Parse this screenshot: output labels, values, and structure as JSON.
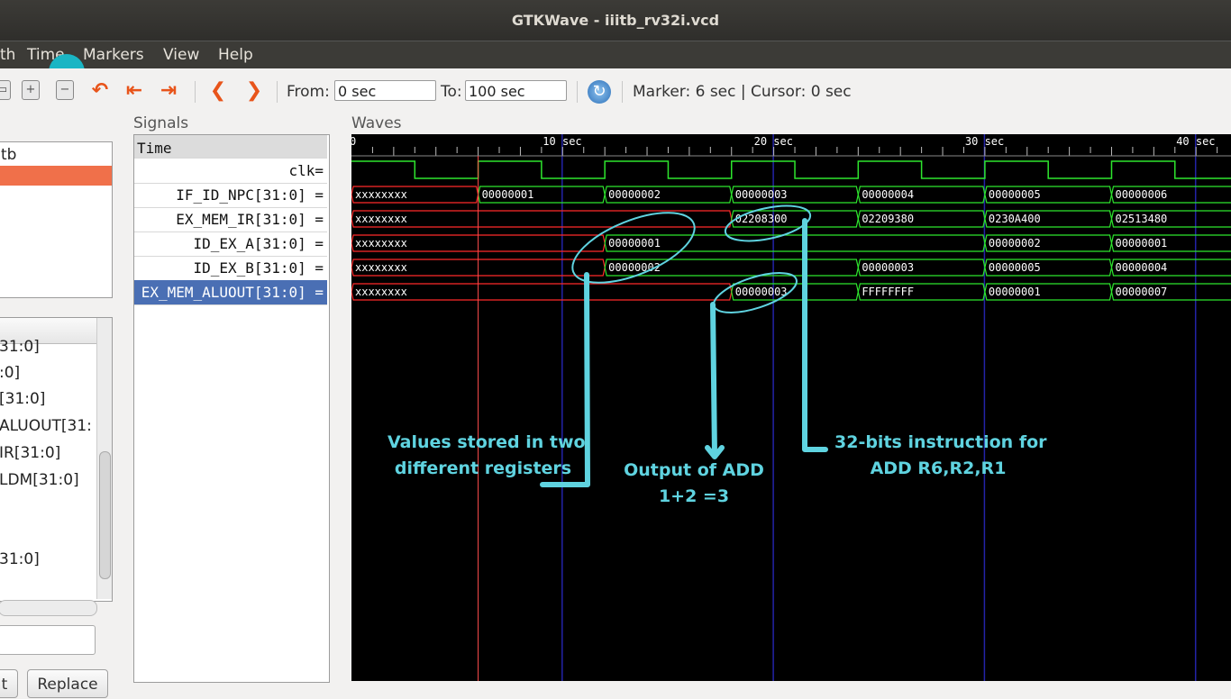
{
  "window": {
    "title": "GTKWave - iiitb_rv32i.vcd"
  },
  "menu": [
    "th",
    "Time",
    "Markers",
    "View",
    "Help"
  ],
  "toolbar": {
    "from_label": "From:",
    "from_value": "0 sec",
    "to_label": "To:",
    "to_value": "100 sec",
    "status": "Marker: 6 sec  |  Cursor: 0 sec"
  },
  "sst": {
    "tree_top": "tb",
    "signal_items": [
      "31:0]",
      ":0]",
      "[31:0]",
      "ALUOUT[31:",
      "IR[31:0]",
      "LDM[31:0]",
      "31:0]"
    ],
    "buttons": [
      "t",
      "Replace"
    ]
  },
  "signals": {
    "label": "Signals",
    "header": "Time",
    "rows": [
      "clk=",
      "IF_ID_NPC[31:0] =",
      "EX_MEM_IR[31:0] =",
      "ID_EX_A[31:0] =",
      "ID_EX_B[31:0] =",
      "EX_MEM_ALUOUT[31:0] ="
    ],
    "selected_index": 5
  },
  "waves": {
    "label": "Waves",
    "time_ticks": [
      "0",
      "10 sec",
      "20 sec",
      "30 sec",
      "40 sec"
    ],
    "buses": [
      {
        "name": "IF_ID_NPC",
        "segments": [
          [
            "xxxxxxxx",
            0,
            6
          ],
          [
            "00000001",
            6,
            12
          ],
          [
            "00000002",
            12,
            18
          ],
          [
            "00000003",
            18,
            24
          ],
          [
            "00000004",
            24,
            30
          ],
          [
            "00000005",
            30,
            36
          ],
          [
            "00000006",
            36,
            42
          ]
        ]
      },
      {
        "name": "EX_MEM_IR",
        "segments": [
          [
            "xxxxxxxx",
            0,
            18
          ],
          [
            "02208300",
            18,
            24
          ],
          [
            "02209380",
            24,
            30
          ],
          [
            "0230A400",
            30,
            36
          ],
          [
            "02513480",
            36,
            42
          ]
        ]
      },
      {
        "name": "ID_EX_A",
        "segments": [
          [
            "xxxxxxxx",
            0,
            12
          ],
          [
            "00000001",
            12,
            30
          ],
          [
            "00000002",
            30,
            36
          ],
          [
            "00000001",
            36,
            42
          ]
        ]
      },
      {
        "name": "ID_EX_B",
        "segments": [
          [
            "xxxxxxxx",
            0,
            12
          ],
          [
            "00000002",
            12,
            24
          ],
          [
            "00000003",
            24,
            30
          ],
          [
            "00000005",
            30,
            36
          ],
          [
            "00000004",
            36,
            42
          ]
        ]
      },
      {
        "name": "EX_MEM_ALUOUT",
        "segments": [
          [
            "xxxxxxxx",
            0,
            18
          ],
          [
            "00000003",
            18,
            24
          ],
          [
            "FFFFFFFF",
            24,
            30
          ],
          [
            "00000001",
            30,
            36
          ],
          [
            "00000007",
            36,
            42
          ]
        ]
      }
    ],
    "marker_time": 6
  },
  "annotations": {
    "a1": [
      "Values stored in two",
      "different registers"
    ],
    "a2": [
      "Output of ADD",
      "1+2 =3"
    ],
    "a3": [
      "32-bits instruction for",
      "ADD R6,R2,R1"
    ]
  },
  "colors": {
    "wave_green": "#2ee62e",
    "xx_red": "#ff2a2a",
    "annotation": "#5fd3e0",
    "selected": "#4a6fb4"
  }
}
